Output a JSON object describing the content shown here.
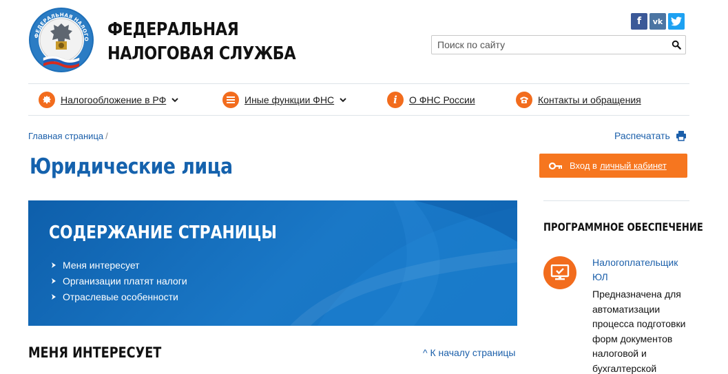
{
  "header": {
    "logo_text": "ФЕДЕРАЛЬНАЯ НАЛОГОВАЯ СЛУЖБА",
    "brand_line1": "ФЕДЕРАЛЬНАЯ",
    "brand_line2": "НАЛОГОВАЯ СЛУЖБА",
    "social": [
      {
        "name": "facebook",
        "glyph": "f",
        "color": "#3b5998"
      },
      {
        "name": "vkontakte",
        "glyph": "vk",
        "color": "#4c75a3"
      },
      {
        "name": "twitter",
        "glyph": "t",
        "color": "#1da1f2"
      }
    ],
    "search": {
      "placeholder": "Поиск по сайту",
      "value": "",
      "icon": "search-icon"
    }
  },
  "nav": {
    "items": [
      {
        "label": "Налогообложение в РФ",
        "icon": "emblem-icon",
        "has_dropdown": true
      },
      {
        "label": "Иные функции ФНС",
        "icon": "menu-icon",
        "has_dropdown": true
      },
      {
        "label": "О ФНС России",
        "icon": "info-icon",
        "has_dropdown": false
      },
      {
        "label": "Контакты и обращения",
        "icon": "phone-icon",
        "has_dropdown": false
      }
    ]
  },
  "breadcrumb": {
    "home": "Главная страница",
    "separator": "/"
  },
  "print_label": "Распечатать",
  "page_title": "Юридические лица",
  "login": {
    "prefix": "Вход в",
    "link": "личный кабинет"
  },
  "contents": {
    "title": "СОДЕРЖАНИЕ СТРАНИЦЫ",
    "items": [
      "Меня интересует",
      "Организации платят налоги",
      "Отраслевые особенности"
    ]
  },
  "section": {
    "title": "МЕНЯ ИНТЕРЕСУЕТ",
    "to_top": "^  К началу страницы"
  },
  "sidebar": {
    "title": "ПРОГРАММНОЕ ОБЕСПЕЧЕНИЕ",
    "software": {
      "name": "Налогоплательщик ЮЛ",
      "description": "Предназначена для автоматизации процесса подготовки форм документов налоговой и бухгалтерской"
    }
  },
  "colors": {
    "accent": "#f26c1d",
    "primary": "#1562ad",
    "link": "#1b5faa",
    "banner": "#1373c2"
  }
}
